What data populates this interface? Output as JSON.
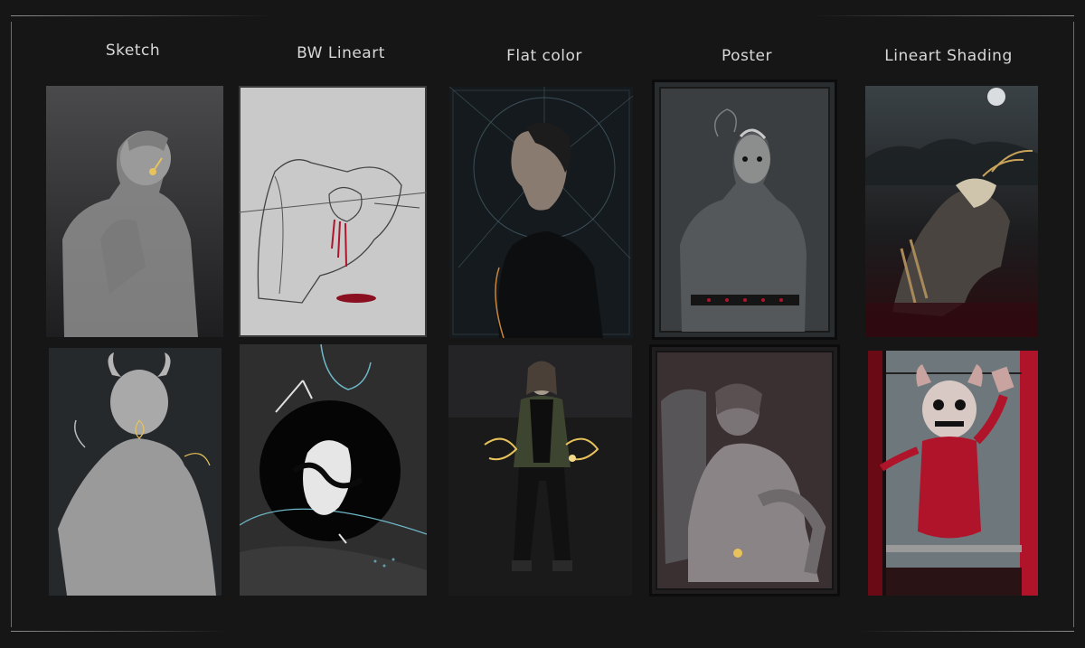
{
  "columns": [
    {
      "id": "sketch",
      "title": "Sketch"
    },
    {
      "id": "bw-lineart",
      "title": "BW Lineart"
    },
    {
      "id": "flat-color",
      "title": "Flat color"
    },
    {
      "id": "poster",
      "title": "Poster"
    },
    {
      "id": "lineart-shading",
      "title": "Lineart Shading"
    }
  ],
  "colors": {
    "background": "#161616",
    "frame_line": "#6d6d6d",
    "title_text": "#d8d8d8",
    "accent_gold": "#e8c25a",
    "accent_red": "#b0142a",
    "accent_teal": "#6fb8c9"
  }
}
